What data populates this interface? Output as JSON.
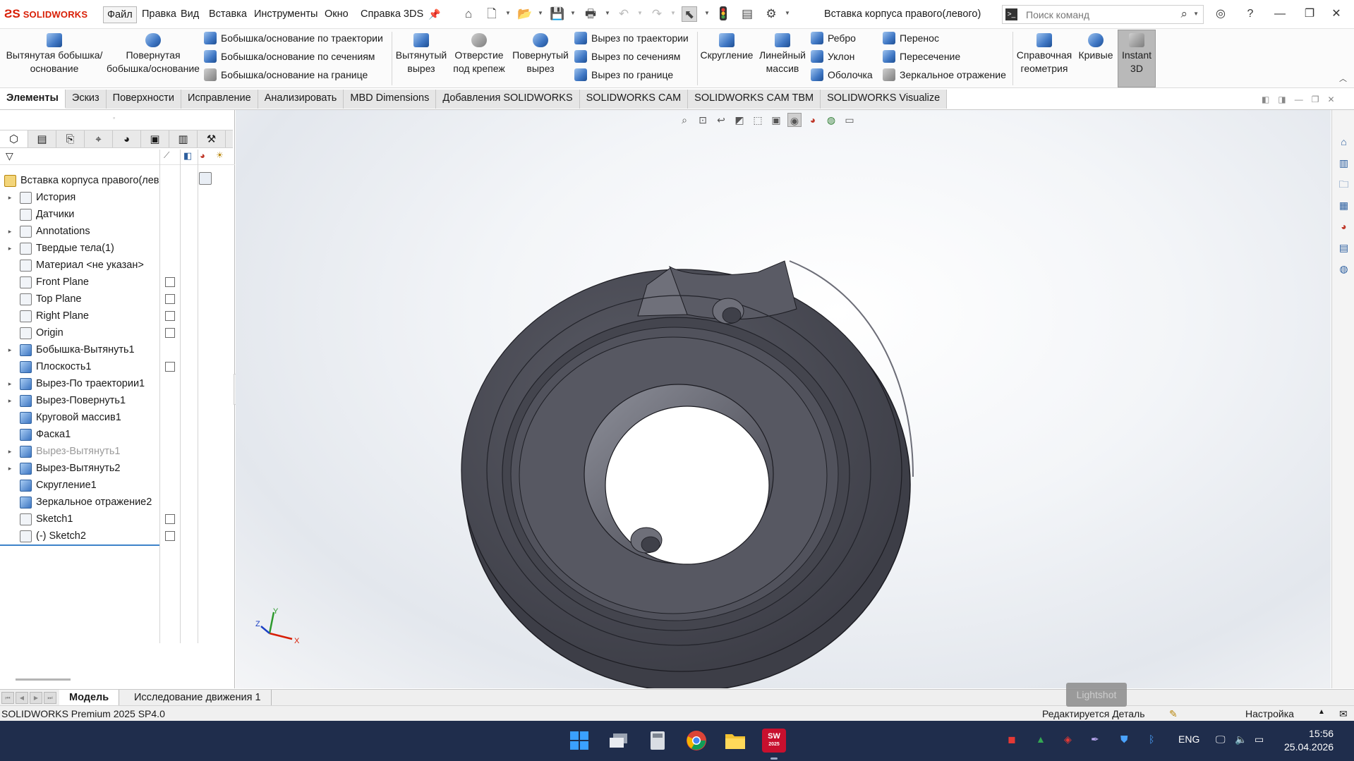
{
  "app": {
    "brand": "SOLIDWORKS",
    "document_title": "Вставка корпуса правого(левого)"
  },
  "menu": [
    {
      "label": "Файл",
      "active": true
    },
    {
      "label": "Правка"
    },
    {
      "label": "Вид"
    },
    {
      "label": "Вставка"
    },
    {
      "label": "Инструменты"
    },
    {
      "label": "Окно"
    },
    {
      "label": "Справка 3DS"
    }
  ],
  "search": {
    "placeholder": "Поиск команд"
  },
  "ribbon": {
    "extruded_boss": "Вытянутая бобышка/основание",
    "revolved_boss": "Повернутая бобышка/основание",
    "swept_boss": "Бобышка/основание по траектории",
    "lofted_boss": "Бобышка/основание по сечениям",
    "boundary_boss": "Бобышка/основание на границе",
    "extruded_cut": "Вытянутый вырез",
    "hole_wizard": "Отверстие под крепеж",
    "revolved_cut": "Повернутый вырез",
    "swept_cut": "Вырез по траектории",
    "lofted_cut": "Вырез по сечениям",
    "boundary_cut": "Вырез по границе",
    "fillet": "Скругление",
    "linear_pattern": "Линейный массив",
    "rib": "Ребро",
    "draft": "Уклон",
    "shell": "Оболочка",
    "wrap": "Перенос",
    "intersect": "Пересечение",
    "mirror": "Зеркальное отражение",
    "ref_geometry": "Справочная геометрия",
    "curves": "Кривые",
    "instant3d": "Instant 3D"
  },
  "tabs": [
    "Элементы",
    "Эскиз",
    "Поверхности",
    "Исправление",
    "Анализировать",
    "MBD Dimensions",
    "Добавления SOLIDWORKS",
    "SOLIDWORKS CAM",
    "SOLIDWORKS CAM TBM",
    "SOLIDWORKS Visualize"
  ],
  "tree": {
    "root": "Вставка корпуса правого(лев",
    "items": [
      {
        "label": "История",
        "icon": "history-icon",
        "expand": true
      },
      {
        "label": "Датчики",
        "icon": "sensors-icon",
        "expand": false
      },
      {
        "label": "Annotations",
        "icon": "annotations-icon",
        "expand": true
      },
      {
        "label": "Твердые тела(1)",
        "icon": "solid-bodies-icon",
        "expand": true
      },
      {
        "label": "Материал <не указан>",
        "icon": "material-icon",
        "expand": false
      },
      {
        "label": "Front Plane",
        "icon": "plane-icon",
        "expand": false
      },
      {
        "label": "Top Plane",
        "icon": "plane-icon",
        "expand": false
      },
      {
        "label": "Right Plane",
        "icon": "plane-icon",
        "expand": false
      },
      {
        "label": "Origin",
        "icon": "origin-icon",
        "expand": false
      },
      {
        "label": "Бобышка-Вытянуть1",
        "icon": "extrude-icon",
        "expand": true
      },
      {
        "label": "Плоскость1",
        "icon": "plane-feature-icon",
        "expand": false
      },
      {
        "label": "Вырез-По траектории1",
        "icon": "swept-cut-icon",
        "expand": true
      },
      {
        "label": "Вырез-Повернуть1",
        "icon": "revolved-cut-icon",
        "expand": true
      },
      {
        "label": "Круговой массив1",
        "icon": "circular-pattern-icon",
        "expand": false
      },
      {
        "label": "Фаска1",
        "icon": "chamfer-icon",
        "expand": false
      },
      {
        "label": "Вырез-Вытянуть1",
        "icon": "extruded-cut-icon",
        "expand": true,
        "suppressed": true
      },
      {
        "label": "Вырез-Вытянуть2",
        "icon": "extruded-cut-icon",
        "expand": true
      },
      {
        "label": "Скругление1",
        "icon": "fillet-icon",
        "expand": false
      },
      {
        "label": "Зеркальное отражение2",
        "icon": "mirror-icon",
        "expand": false
      },
      {
        "label": "Sketch1",
        "icon": "sketch-icon",
        "expand": false
      },
      {
        "label": "(-) Sketch2",
        "icon": "sketch-icon",
        "expand": false
      }
    ]
  },
  "triad": {
    "x": "X",
    "y": "Y",
    "z": "Z"
  },
  "bottom_tabs": [
    "Модель",
    "Исследование движения 1"
  ],
  "status": {
    "version": "SOLIDWORKS Premium 2025 SP4.0",
    "mode": "Редактируется Деталь",
    "units": "Настройка"
  },
  "overlay": {
    "lightshot": "Lightshot"
  },
  "taskbar": {
    "sw_badge": "SW",
    "sw_year": "2025",
    "lang": "ENG",
    "time": "15:56",
    "date": "25.04.2026"
  },
  "colors": {
    "brand_red": "#d81e05",
    "part_body": "#4a4b55",
    "taskbar_bg": "#1f2d4c",
    "selection_blue": "#3d83c9"
  }
}
